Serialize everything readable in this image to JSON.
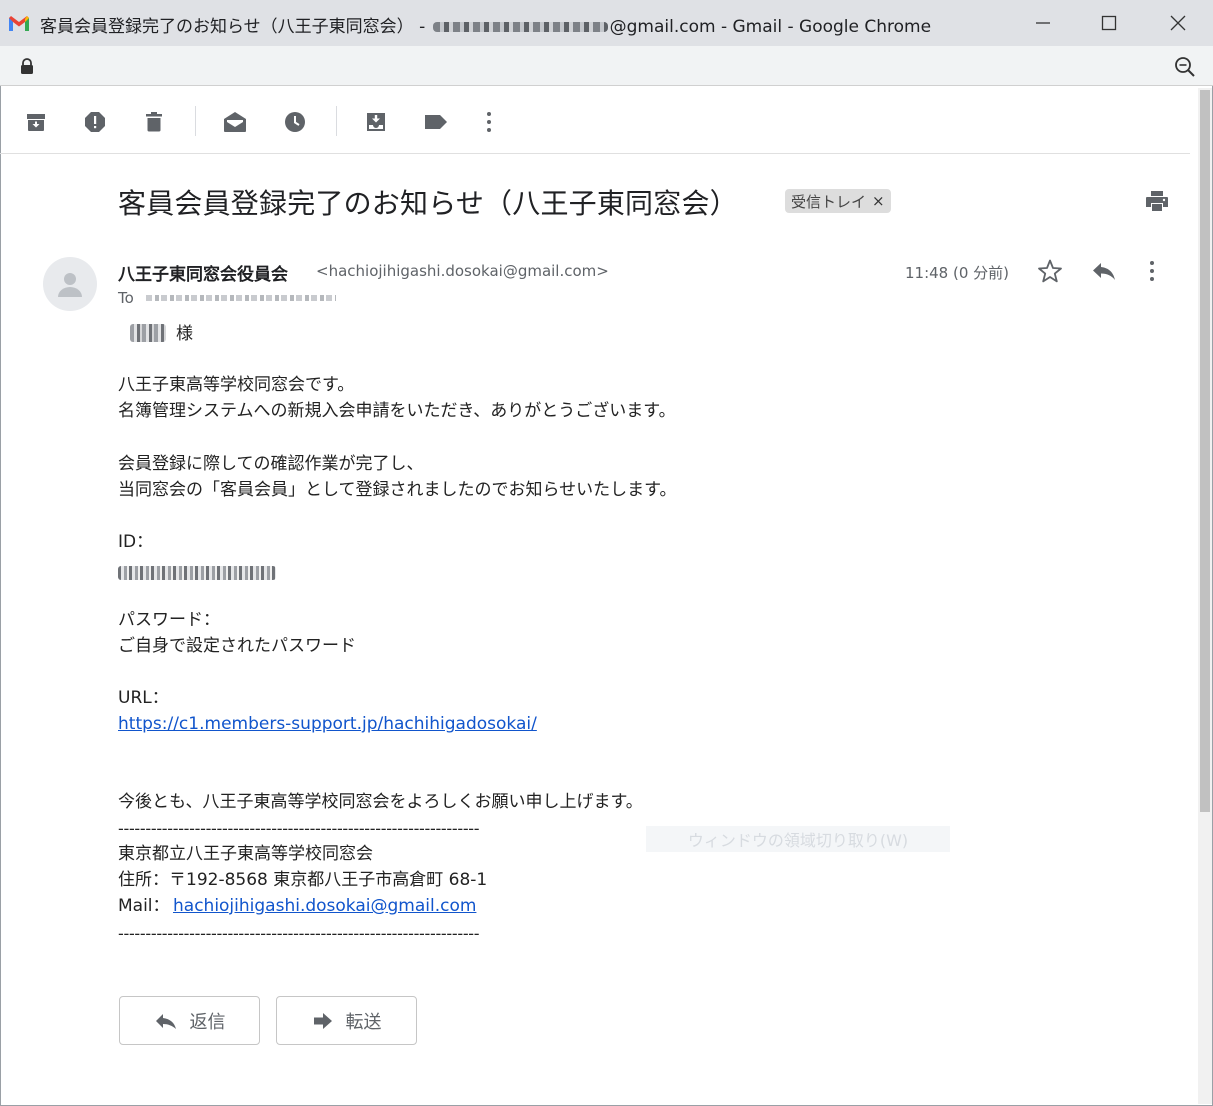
{
  "window": {
    "title_prefix": "客員会員登録完了のお知らせ（八王子東同窓会） - ",
    "title_suffix": "@gmail.com - Gmail - Google Chrome"
  },
  "email": {
    "subject": "客員会員登録完了のお知らせ（八王子東同窓会）",
    "label": "受信トレイ",
    "label_close": "×",
    "sender_name": "八王子東同窓会役員会",
    "sender_email": "<hachiojihigashi.dosokai@gmail.com>",
    "to_label": "To",
    "time": "11:48 (0 分前)",
    "body": {
      "salutation": "様",
      "line1": "八王子東高等学校同窓会です。",
      "line2": "名簿管理システムへの新規入会申請をいただき、ありがとうございます。",
      "line3": "会員登録に際しての確認作業が完了し、",
      "line4": "当同窓会の「客員会員」として登録されましたのでお知らせいたします。",
      "id_label": "ID：",
      "password_label": "パスワード：",
      "password_value": "ご自身で設定されたパスワード",
      "url_label": "URL：",
      "url": "https://c1.members-support.jp/hachihigadosokai/",
      "closing": "今後とも、八王子東高等学校同窓会をよろしくお願い申し上げます。",
      "divider": "------------------------------------------------------------------",
      "org": "東京都立八王子東高等学校同窓会",
      "address": "住所：〒192-8568 東京都八王子市高倉町 68-1",
      "mail_label": "Mail：",
      "mail": "hachiojihigashi.dosokai@gmail.com"
    }
  },
  "overlay_text": "ウィンドウの領域切り取り(W)",
  "actions": {
    "reply": "返信",
    "forward": "転送"
  },
  "colors": {
    "link": "#1155cc",
    "icon": "#5f6368"
  }
}
